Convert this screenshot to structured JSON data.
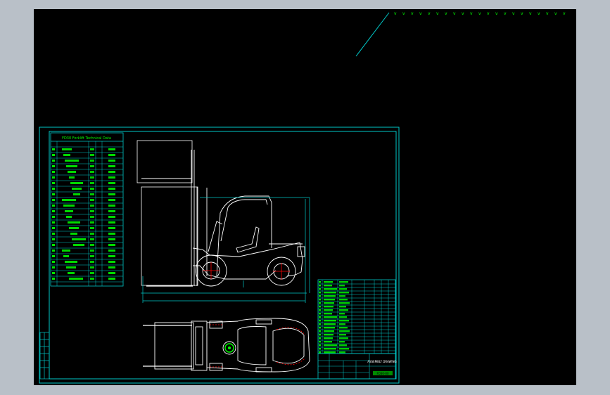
{
  "app": {
    "title": "",
    "view": "model-space"
  },
  "drawing": {
    "sheet_title": "FD30 Forklift Technical Data",
    "title_block_name": "ASSEMBLY DRAWING",
    "title_block_code": "FD30-00",
    "tick_mark": "v"
  },
  "colors": {
    "background": "#000000",
    "frame_gray": "#b9c0c8",
    "border": "#00c8c8",
    "geometry": "#ffffff",
    "table_text": "#00ff00",
    "centerline": "#ff0000",
    "dimension": "#00c8c8"
  }
}
